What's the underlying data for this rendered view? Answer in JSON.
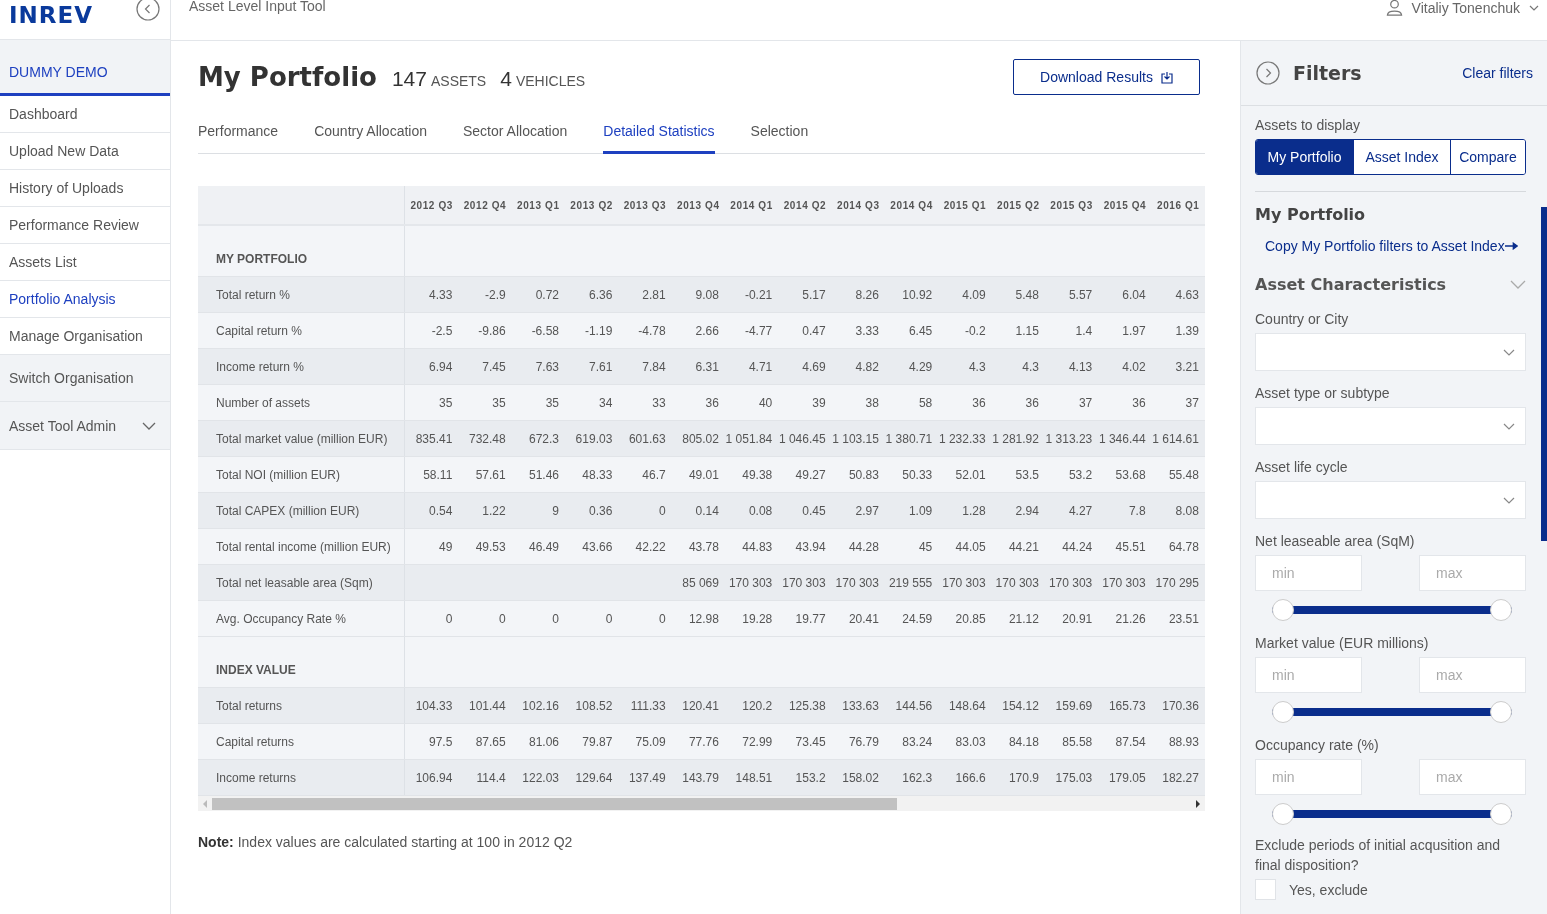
{
  "header": {
    "app_title": "Asset Level Input Tool",
    "user": "Vitaliy Tonenchuk"
  },
  "logo": "INREV",
  "sidebar": {
    "organisation": "DUMMY DEMO",
    "items": [
      {
        "label": "Dashboard",
        "kind": "link",
        "selected": false
      },
      {
        "label": "Upload New Data",
        "kind": "link",
        "selected": false
      },
      {
        "label": "History of Uploads",
        "kind": "link",
        "selected": false
      },
      {
        "label": "Performance Review",
        "kind": "link",
        "selected": false
      },
      {
        "label": "Assets List",
        "kind": "link",
        "selected": false
      },
      {
        "label": "Portfolio Analysis",
        "kind": "link",
        "selected": true
      },
      {
        "label": "Manage Organisation",
        "kind": "link",
        "selected": false
      },
      {
        "label": "Switch Organisation",
        "kind": "action",
        "selected": false
      },
      {
        "label": "Asset Tool Admin",
        "kind": "menu",
        "selected": false,
        "expanded": false
      }
    ]
  },
  "page": {
    "title": "My Portfolio",
    "assets_count": "147",
    "assets_label": "ASSETS",
    "vehicles_count": "4",
    "vehicles_label": "VEHICLES",
    "download_button": "Download Results"
  },
  "tabs": [
    {
      "label": "Performance",
      "selected": false
    },
    {
      "label": "Country Allocation",
      "selected": false
    },
    {
      "label": "Sector Allocation",
      "selected": false
    },
    {
      "label": "Detailed Statistics",
      "selected": true
    },
    {
      "label": "Selection",
      "selected": false
    }
  ],
  "table": {
    "columns": [
      "2012 Q3",
      "2012 Q4",
      "2013 Q1",
      "2013 Q2",
      "2013 Q3",
      "2013 Q4",
      "2014 Q1",
      "2014 Q2",
      "2014 Q3",
      "2014 Q4",
      "2015 Q1",
      "2015 Q2",
      "2015 Q3",
      "2015 Q4",
      "2016 Q1"
    ],
    "sections": [
      {
        "title": "MY PORTFOLIO",
        "rows": [
          {
            "label": "Total return %",
            "values": [
              "4.33",
              "-2.9",
              "0.72",
              "6.36",
              "2.81",
              "9.08",
              "-0.21",
              "5.17",
              "8.26",
              "10.92",
              "4.09",
              "5.48",
              "5.57",
              "6.04",
              "4.63"
            ]
          },
          {
            "label": "Capital return %",
            "values": [
              "-2.5",
              "-9.86",
              "-6.58",
              "-1.19",
              "-4.78",
              "2.66",
              "-4.77",
              "0.47",
              "3.33",
              "6.45",
              "-0.2",
              "1.15",
              "1.4",
              "1.97",
              "1.39"
            ]
          },
          {
            "label": "Income return %",
            "values": [
              "6.94",
              "7.45",
              "7.63",
              "7.61",
              "7.84",
              "6.31",
              "4.71",
              "4.69",
              "4.82",
              "4.29",
              "4.3",
              "4.3",
              "4.13",
              "4.02",
              "3.21"
            ]
          },
          {
            "label": "Number of assets",
            "values": [
              "35",
              "35",
              "35",
              "34",
              "33",
              "36",
              "40",
              "39",
              "38",
              "58",
              "36",
              "36",
              "37",
              "36",
              "37"
            ]
          },
          {
            "label": "Total market value (million EUR)",
            "values": [
              "835.41",
              "732.48",
              "672.3",
              "619.03",
              "601.63",
              "805.02",
              "1 051.84",
              "1 046.45",
              "1 103.15",
              "1 380.71",
              "1 232.33",
              "1 281.92",
              "1 313.23",
              "1 346.44",
              "1 614.61"
            ]
          },
          {
            "label": "Total NOI (million EUR)",
            "values": [
              "58.11",
              "57.61",
              "51.46",
              "48.33",
              "46.7",
              "49.01",
              "49.38",
              "49.27",
              "50.83",
              "50.33",
              "52.01",
              "53.5",
              "53.2",
              "53.68",
              "55.48"
            ]
          },
          {
            "label": "Total CAPEX (million EUR)",
            "values": [
              "0.54",
              "1.22",
              "9",
              "0.36",
              "0",
              "0.14",
              "0.08",
              "0.45",
              "2.97",
              "1.09",
              "1.28",
              "2.94",
              "4.27",
              "7.8",
              "8.08"
            ]
          },
          {
            "label": "Total rental income (million EUR)",
            "values": [
              "49",
              "49.53",
              "46.49",
              "43.66",
              "42.22",
              "43.78",
              "44.83",
              "43.94",
              "44.28",
              "45",
              "44.05",
              "44.21",
              "44.24",
              "45.51",
              "64.78"
            ]
          },
          {
            "label": "Total net leasable area (Sqm)",
            "values": [
              "85 069",
              "170 303",
              "170 303",
              "170 303",
              "219 555",
              "170 303",
              "170 303",
              "170 303",
              "170 303",
              "170 295"
            ]
          },
          {
            "label": "Avg. Occupancy Rate %",
            "values": [
              "0",
              "0",
              "0",
              "0",
              "0",
              "12.98",
              "19.28",
              "19.77",
              "20.41",
              "24.59",
              "20.85",
              "21.12",
              "20.91",
              "21.26",
              "23.51"
            ]
          }
        ]
      },
      {
        "title": "INDEX VALUE",
        "rows": [
          {
            "label": "Total returns",
            "values": [
              "104.33",
              "101.44",
              "102.16",
              "108.52",
              "111.33",
              "120.41",
              "120.2",
              "125.38",
              "133.63",
              "144.56",
              "148.64",
              "154.12",
              "159.69",
              "165.73",
              "170.36"
            ]
          },
          {
            "label": "Capital returns",
            "values": [
              "97.5",
              "87.65",
              "81.06",
              "79.87",
              "75.09",
              "77.76",
              "72.99",
              "73.45",
              "76.79",
              "83.24",
              "83.03",
              "84.18",
              "85.58",
              "87.54",
              "88.93"
            ]
          },
          {
            "label": "Income returns",
            "values": [
              "106.94",
              "114.4",
              "122.03",
              "129.64",
              "137.49",
              "143.79",
              "148.51",
              "153.2",
              "158.02",
              "162.3",
              "166.6",
              "170.9",
              "175.03",
              "179.05",
              "182.27"
            ]
          }
        ]
      }
    ]
  },
  "note": "**Note:** Index values are calculated starting at 100 in 2012 Q2",
  "filters": {
    "title": "Filters",
    "clear": "Clear filters",
    "assets_label": "Assets to display",
    "display_options": [
      {
        "label": "My Portfolio",
        "selected": true
      },
      {
        "label": "Asset Index",
        "selected": false
      },
      {
        "label": "Compare",
        "selected": false
      }
    ],
    "section_title": "My Portfolio",
    "copy_link": "Copy My Portfolio filters to Asset Index",
    "group_title": "Asset Characteristics",
    "group_expanded": true,
    "dropdowns": [
      {
        "label": "Country or City"
      },
      {
        "label": "Asset type or subtype"
      },
      {
        "label": "Asset life cycle"
      }
    ],
    "ranges": [
      {
        "label": "Net leaseable area (SqM)",
        "min_placeholder": "min",
        "max_placeholder": "max",
        "level": 1
      },
      {
        "label": "Market value (EUR millions)",
        "min_placeholder": "min",
        "max_placeholder": "max",
        "level": 1
      },
      {
        "label": "Occupancy rate (%)",
        "min_placeholder": "min",
        "max_placeholder": "max",
        "level": 1
      }
    ],
    "exclude_question": "Exclude periods of initial acqusition and final disposition?",
    "exclude_option": {
      "label": "Yes, exclude",
      "checked": false
    }
  }
}
